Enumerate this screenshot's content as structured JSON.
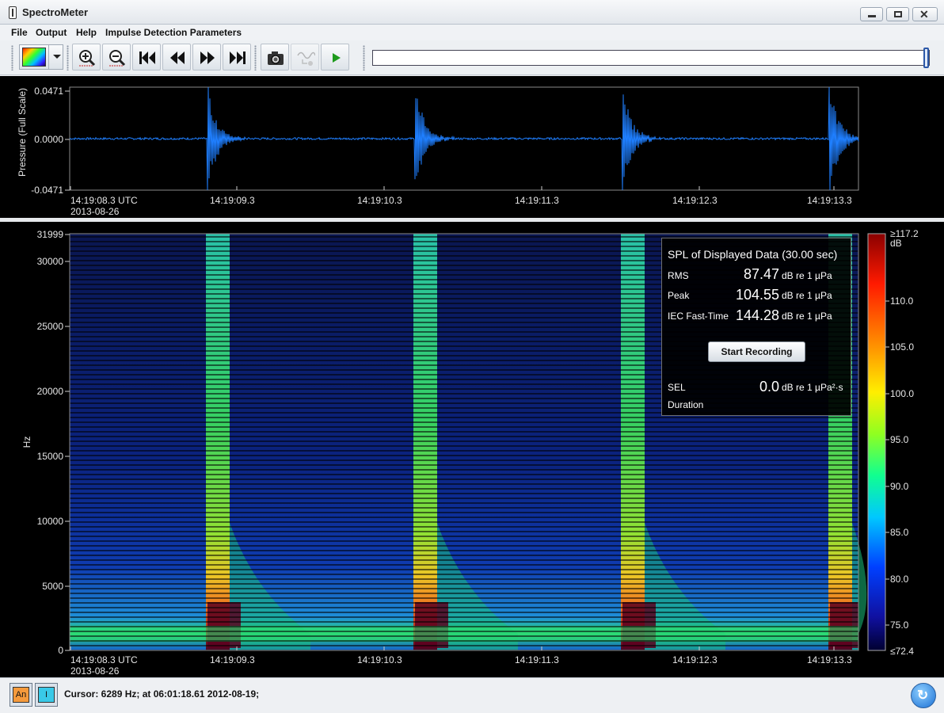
{
  "window": {
    "title": "SpectroMeter"
  },
  "menu": [
    "File",
    "Output",
    "Help",
    "Impulse Detection Parameters"
  ],
  "toolbar": {
    "buttons": [
      "colormap-selector",
      "zoom-in",
      "zoom-out",
      "skip-to-start",
      "rewind",
      "fast-forward",
      "skip-to-end",
      "snapshot",
      "impulse-detect",
      "play"
    ]
  },
  "waveform": {
    "ylabel": "Pressure (Full Scale)",
    "yticks": [
      "0.0471",
      "0.0000",
      "-0.0471"
    ],
    "xticks": [
      "14:19:08.3 UTC",
      "14:19:09.3",
      "14:19:10.3",
      "14:19:11.3",
      "14:19:12.3",
      "14:19:13.3"
    ],
    "date": "2013-08-26",
    "color": "#1f7fff"
  },
  "spectrogram": {
    "ylabel": "Hz",
    "yticks": [
      "31999",
      "30000",
      "25000",
      "20000",
      "15000",
      "10000",
      "5000",
      "0"
    ],
    "xticks": [
      "14:19:08.3 UTC",
      "14:19:09.3",
      "14:19:10.3",
      "14:19:11.3",
      "14:19:12.3",
      "14:19:13.3"
    ],
    "date": "2013-08-26",
    "colorbar_ticks": [
      "≥117.2",
      "dB",
      "110.0",
      "105.0",
      "100.0",
      "95.0",
      "90.0",
      "85.0",
      "80.0",
      "75.0",
      "≤72.4"
    ]
  },
  "chart_data": [
    {
      "type": "line",
      "ylabel": "Pressure (Full Scale)",
      "ylim": [
        -0.0471,
        0.0471
      ],
      "x_tick_labels": [
        "14:19:08.3 UTC",
        "14:19:09.3",
        "14:19:10.3",
        "14:19:11.3",
        "14:19:12.3",
        "14:19:13.3"
      ],
      "series": [
        {
          "impulses_at_sec_after_start": [
            0.87,
            2.18,
            3.49,
            4.8
          ],
          "peak_amplitude": 0.0471,
          "baseline": 0.0
        }
      ]
    },
    {
      "type": "heatmap",
      "ylabel": "Hz",
      "ylim": [
        0,
        31999
      ],
      "color_range_db": [
        72.4,
        117.2
      ],
      "x_tick_labels": [
        "14:19:08.3 UTC",
        "14:19:09.3",
        "14:19:10.3",
        "14:19:11.3",
        "14:19:12.3",
        "14:19:13.3"
      ]
    }
  ],
  "spl": {
    "title": "SPL of Displayed Data (30.00 sec)",
    "rms_label": "RMS",
    "rms_value": "87.47",
    "rms_unit": "dB re 1 µPa",
    "peak_label": "Peak",
    "peak_value": "104.55",
    "peak_unit": "dB re 1 µPa",
    "iec_label": "IEC Fast-Time",
    "iec_value": "144.28",
    "iec_unit": "dB re 1 µPa",
    "button": "Start Recording",
    "sel_label": "SEL",
    "sel_value": "0.0",
    "sel_unit": "dB re 1 µPa²·s",
    "duration_label": "Duration"
  },
  "status": {
    "an_label": "An",
    "i_label": "I",
    "cursor": "Cursor: 6289 Hz; at 06:01:18.61 2012-08-19;"
  }
}
